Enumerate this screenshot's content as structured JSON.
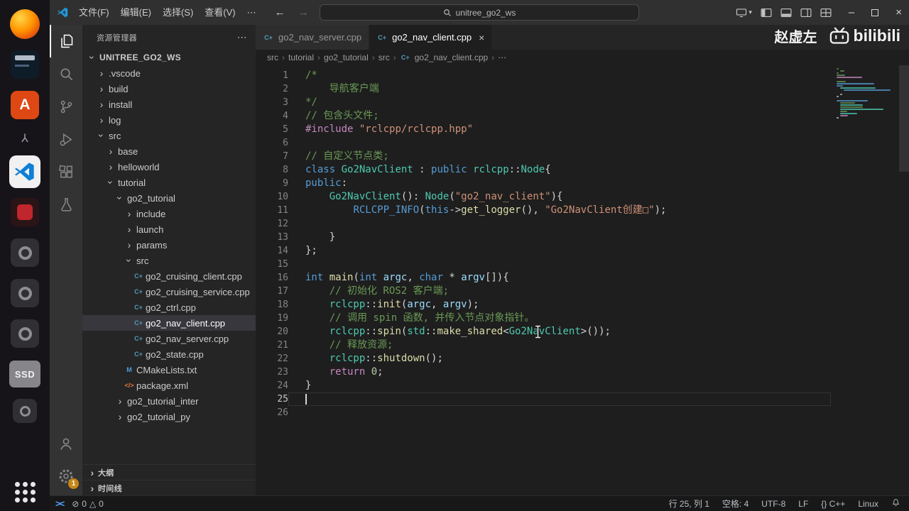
{
  "colors": {
    "accent": "#3794ff",
    "badge": "#c78616",
    "selection_bg": "#37373d",
    "vscode_blue": "#0f7fd6",
    "ubuntu_orange": "#dd4814"
  },
  "glyphs": {
    "chevron": "›",
    "more": "⋯",
    "back": "←",
    "forward": "→",
    "minimize": "–",
    "close": "×",
    "error": "⊘",
    "warning": "△",
    "dropdown": "▾",
    "remote": "><"
  },
  "watermark": {
    "author": "赵虚左",
    "brand": "bilibili"
  },
  "titlebar": {
    "menus": [
      {
        "label": "文件(F)"
      },
      {
        "label": "编辑(E)"
      },
      {
        "label": "选择(S)"
      },
      {
        "label": "查看(V)"
      },
      {
        "label": "⋯"
      }
    ],
    "search_value": "unitree_go2_ws"
  },
  "dock": {
    "apps": [
      "firefox",
      "dark-files-app",
      "software-center-a",
      "mini-utility",
      "vscode",
      "red-media-app",
      "placeholder-1",
      "placeholder-2",
      "placeholder-3",
      "ssd-drive",
      "placeholder-4",
      "app-grid"
    ],
    "ssd_label": "SSD"
  },
  "activitybar": {
    "items": [
      "explorer",
      "search",
      "source-control",
      "run-debug",
      "extensions",
      "testing"
    ],
    "bottom": [
      "account",
      "settings"
    ],
    "settings_badge": "1"
  },
  "sidebar": {
    "title": "资源管理器",
    "actions_more": "⋯",
    "chevron_glyph": "›",
    "file_icon_glyphs": {
      "cpp": "C+",
      "cmake": "M",
      "xml": "</>"
    },
    "tree": [
      {
        "label": "UNITREE_GO2_WS",
        "level": 0,
        "kind": "folder",
        "state": "expanded",
        "bold": true
      },
      {
        "label": ".vscode",
        "level": 1,
        "kind": "folder",
        "state": "collapsed"
      },
      {
        "label": "build",
        "level": 1,
        "kind": "folder",
        "state": "collapsed"
      },
      {
        "label": "install",
        "level": 1,
        "kind": "folder",
        "state": "collapsed"
      },
      {
        "label": "log",
        "level": 1,
        "kind": "folder",
        "state": "collapsed"
      },
      {
        "label": "src",
        "level": 1,
        "kind": "folder",
        "state": "expanded"
      },
      {
        "label": "base",
        "level": 2,
        "kind": "folder",
        "state": "collapsed"
      },
      {
        "label": "helloworld",
        "level": 2,
        "kind": "folder",
        "state": "collapsed"
      },
      {
        "label": "tutorial",
        "level": 2,
        "kind": "folder",
        "state": "expanded"
      },
      {
        "label": "go2_tutorial",
        "level": 3,
        "kind": "folder",
        "state": "expanded"
      },
      {
        "label": "include",
        "level": 4,
        "kind": "folder",
        "state": "collapsed"
      },
      {
        "label": "launch",
        "level": 4,
        "kind": "folder",
        "state": "collapsed"
      },
      {
        "label": "params",
        "level": 4,
        "kind": "folder",
        "state": "collapsed"
      },
      {
        "label": "src",
        "level": 4,
        "kind": "folder",
        "state": "expanded"
      },
      {
        "label": "go2_cruising_client.cpp",
        "level": 5,
        "kind": "file",
        "icon": "cpp"
      },
      {
        "label": "go2_cruising_service.cpp",
        "level": 5,
        "kind": "file",
        "icon": "cpp"
      },
      {
        "label": "go2_ctrl.cpp",
        "level": 5,
        "kind": "file",
        "icon": "cpp"
      },
      {
        "label": "go2_nav_client.cpp",
        "level": 5,
        "kind": "file",
        "icon": "cpp",
        "selected": true
      },
      {
        "label": "go2_nav_server.cpp",
        "level": 5,
        "kind": "file",
        "icon": "cpp"
      },
      {
        "label": "go2_state.cpp",
        "level": 5,
        "kind": "file",
        "icon": "cpp"
      },
      {
        "label": "CMakeLists.txt",
        "level": 4,
        "kind": "file",
        "icon": "cmake"
      },
      {
        "label": "package.xml",
        "level": 4,
        "kind": "file",
        "icon": "xml"
      },
      {
        "label": "go2_tutorial_inter",
        "level": 3,
        "kind": "folder",
        "state": "collapsed"
      },
      {
        "label": "go2_tutorial_py",
        "level": 3,
        "kind": "folder",
        "state": "collapsed"
      }
    ],
    "panels": [
      {
        "label": "大纲"
      },
      {
        "label": "时间线"
      }
    ]
  },
  "tabs": [
    {
      "label": "go2_nav_server.cpp",
      "icon": "cpp",
      "active": false
    },
    {
      "label": "go2_nav_client.cpp",
      "icon": "cpp",
      "active": true,
      "close": "×"
    }
  ],
  "breadcrumbs": [
    "src",
    "tutorial",
    "go2_tutorial",
    "src",
    "go2_nav_client.cpp",
    "⋯"
  ],
  "code": {
    "cursor_line": 25,
    "token_colors": {
      "cm": "#6A9955",
      "kw": "#569CD6",
      "ct": "#C586C0",
      "ty": "#4EC9B0",
      "fn": "#DCDCAA",
      "st": "#CE9178",
      "va": "#9CDCFE",
      "nu": "#B5CEA8",
      "pl": "#D4D4D4",
      "pp": "#C586C0",
      "mc": "#569CD6"
    },
    "lines": [
      [
        [
          "cm",
          "/*"
        ]
      ],
      [
        [
          "cm",
          "    导航客户端"
        ]
      ],
      [
        [
          "cm",
          "*/"
        ]
      ],
      [
        [
          "cm",
          "// 包含头文件;"
        ]
      ],
      [
        [
          "pp",
          "#include"
        ],
        [
          "pl",
          " "
        ],
        [
          "st",
          "\"rclcpp/rclcpp.hpp\""
        ]
      ],
      [],
      [
        [
          "cm",
          "// 自定义节点类;"
        ]
      ],
      [
        [
          "kw",
          "class"
        ],
        [
          "pl",
          " "
        ],
        [
          "ty",
          "Go2NavClient"
        ],
        [
          "pl",
          " : "
        ],
        [
          "kw",
          "public"
        ],
        [
          "pl",
          " "
        ],
        [
          "ty",
          "rclcpp"
        ],
        [
          "pl",
          "::"
        ],
        [
          "ty",
          "Node"
        ],
        [
          "pl",
          "{"
        ]
      ],
      [
        [
          "kw",
          "public"
        ],
        [
          "pl",
          ":"
        ]
      ],
      [
        [
          "pl",
          "    "
        ],
        [
          "ty",
          "Go2NavClient"
        ],
        [
          "pl",
          "(): "
        ],
        [
          "ty",
          "Node"
        ],
        [
          "pl",
          "("
        ],
        [
          "st",
          "\"go2_nav_client\""
        ],
        [
          "pl",
          "){"
        ]
      ],
      [
        [
          "pl",
          "        "
        ],
        [
          "mc",
          "RCLCPP_INFO"
        ],
        [
          "pl",
          "("
        ],
        [
          "kw",
          "this"
        ],
        [
          "pl",
          "->"
        ],
        [
          "fn",
          "get_logger"
        ],
        [
          "pl",
          "(), "
        ],
        [
          "st",
          "\"Go2NavClient创建□\""
        ],
        [
          "pl",
          ");"
        ]
      ],
      [],
      [
        [
          "pl",
          "    }"
        ]
      ],
      [
        [
          "pl",
          "};"
        ]
      ],
      [],
      [
        [
          "kw",
          "int"
        ],
        [
          "pl",
          " "
        ],
        [
          "fn",
          "main"
        ],
        [
          "pl",
          "("
        ],
        [
          "kw",
          "int"
        ],
        [
          "pl",
          " "
        ],
        [
          "va",
          "argc"
        ],
        [
          "pl",
          ", "
        ],
        [
          "kw",
          "char"
        ],
        [
          "pl",
          " * "
        ],
        [
          "va",
          "argv"
        ],
        [
          "pl",
          "[]){"
        ]
      ],
      [
        [
          "pl",
          "    "
        ],
        [
          "cm",
          "// 初始化 ROS2 客户端;"
        ]
      ],
      [
        [
          "pl",
          "    "
        ],
        [
          "ty",
          "rclcpp"
        ],
        [
          "pl",
          "::"
        ],
        [
          "fn",
          "init"
        ],
        [
          "pl",
          "("
        ],
        [
          "va",
          "argc"
        ],
        [
          "pl",
          ", "
        ],
        [
          "va",
          "argv"
        ],
        [
          "pl",
          ");"
        ]
      ],
      [
        [
          "pl",
          "    "
        ],
        [
          "cm",
          "// 调用 spin 函数, 并传入节点对象指针。"
        ]
      ],
      [
        [
          "pl",
          "    "
        ],
        [
          "ty",
          "rclcpp"
        ],
        [
          "pl",
          "::"
        ],
        [
          "fn",
          "spin"
        ],
        [
          "pl",
          "("
        ],
        [
          "ty",
          "std"
        ],
        [
          "pl",
          "::"
        ],
        [
          "fn",
          "make_shared"
        ],
        [
          "pl",
          "<"
        ],
        [
          "ty",
          "Go2NavClient"
        ],
        [
          "pl",
          ">());"
        ]
      ],
      [
        [
          "pl",
          "    "
        ],
        [
          "cm",
          "// 释放资源;"
        ]
      ],
      [
        [
          "pl",
          "    "
        ],
        [
          "ty",
          "rclcpp"
        ],
        [
          "pl",
          "::"
        ],
        [
          "fn",
          "shutdown"
        ],
        [
          "pl",
          "();"
        ]
      ],
      [
        [
          "pl",
          "    "
        ],
        [
          "ct",
          "return"
        ],
        [
          "pl",
          " "
        ],
        [
          "nu",
          "0"
        ],
        [
          "pl",
          ";"
        ]
      ],
      [
        [
          "pl",
          "}"
        ]
      ],
      [],
      []
    ]
  },
  "statusbar": {
    "remote_glyph": "><",
    "errors": "0",
    "warnings": "0",
    "right": [
      "行 25, 列 1",
      "空格: 4",
      "UTF-8",
      "LF",
      "{} C++",
      "Linux"
    ]
  }
}
